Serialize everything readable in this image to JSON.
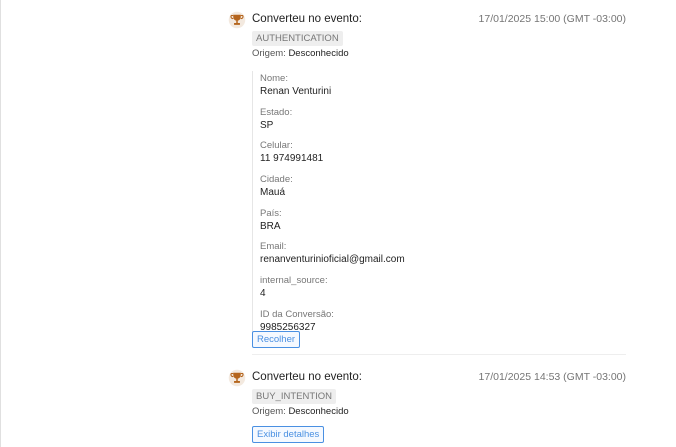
{
  "events": [
    {
      "title": "Converteu no evento:",
      "timestamp": "17/01/2025 15:00 (GMT -03:00)",
      "tag": "AUTHENTICATION",
      "origin_label": "Origem:",
      "origin_value": "Desconhecido",
      "fields": [
        {
          "label": "Nome:",
          "value": "Renan Venturini"
        },
        {
          "label": "Estado:",
          "value": "SP"
        },
        {
          "label": "Celular:",
          "value": "11 974991481"
        },
        {
          "label": "Cidade:",
          "value": "Mauá"
        },
        {
          "label": "País:",
          "value": "BRA"
        },
        {
          "label": "Email:",
          "value": "renanventurinioficial@gmail.com"
        },
        {
          "label": "internal_source:",
          "value": "4"
        },
        {
          "label": "ID da Conversão:",
          "value": "9985256327"
        }
      ],
      "toggle_label": "Recolher"
    },
    {
      "title": "Converteu no evento:",
      "timestamp": "17/01/2025 14:53 (GMT -03:00)",
      "tag": "BUY_INTENTION",
      "origin_label": "Origem:",
      "origin_value": "Desconhecido",
      "toggle_label": "Exibir detalhes"
    }
  ],
  "colors": {
    "trophy": "#b5651d",
    "link": "#4a90e2"
  },
  "icons": {
    "event": "trophy-icon"
  }
}
